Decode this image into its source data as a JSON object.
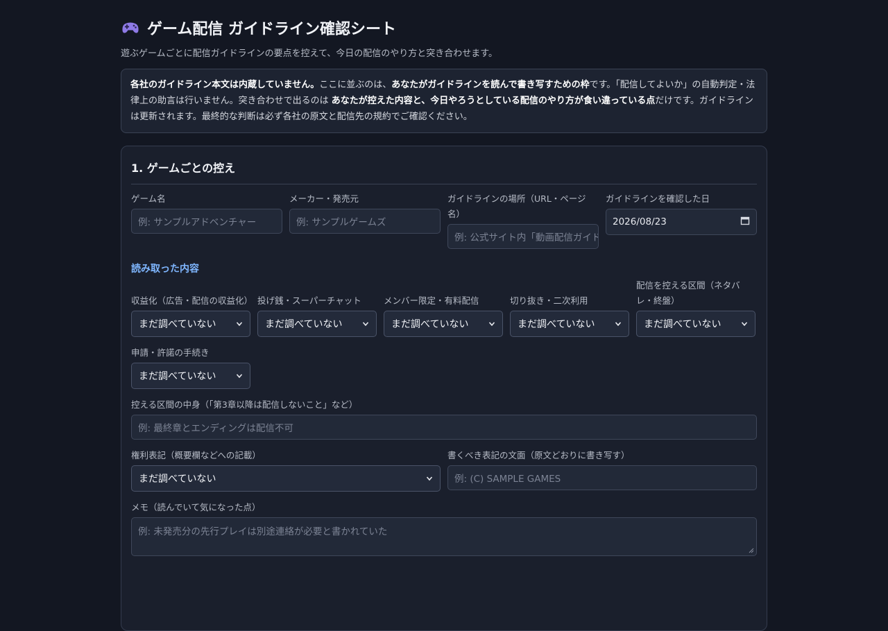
{
  "page": {
    "title": "ゲーム配信 ガイドライン確認シート",
    "title_icon": "gamepad-icon",
    "subtitle": "遊ぶゲームごとに配信ガイドラインの要点を控えて、今日の配信のやり方と突き合わせます。"
  },
  "notice": {
    "p1_b": "各社のガイドライン本文は内蔵していません。",
    "p2": "ここに並ぶのは、",
    "p3_b": "あなたがガイドラインを読んで書き写すための枠",
    "p4": "です。「配信してよいか」の自動判定・法律上の助言は行いません。突き合わせで出るのは ",
    "p5_b": "あなたが控えた内容と、今日やろうとしている配信のやり方が食い違っている点",
    "p6": "だけです。ガイドラインは更新されます。最終的な判断は必ず各社の原文と配信先の規約でご確認ください。"
  },
  "section": {
    "title": "1. ゲームごとの控え",
    "fields": {
      "game_name": {
        "label": "ゲーム名",
        "placeholder": "例: サンプルアドベンチャー"
      },
      "maker": {
        "label": "メーカー・発売元",
        "placeholder": "例: サンプルゲームズ"
      },
      "location": {
        "label": "ガイドラインの場所（URL・ページ名）",
        "placeholder": "例: 公式サイト内「動画配信ガイド」"
      },
      "checked_date": {
        "label": "ガイドラインを確認した日",
        "value": "2026/08/23"
      }
    },
    "read_header": "読み取った内容",
    "selects": [
      {
        "label": "収益化（広告・配信の収益化）",
        "value": "まだ調べていない"
      },
      {
        "label": "投げ銭・スーパーチャット",
        "value": "まだ調べていない"
      },
      {
        "label": "メンバー限定・有料配信",
        "value": "まだ調べていない"
      },
      {
        "label": "切り抜き・二次利用",
        "value": "まだ調べていない"
      },
      {
        "label": "配信を控える区間（ネタバレ・終盤）",
        "value": "まだ調べていない"
      }
    ],
    "permission": {
      "label": "申請・許諾の手続き",
      "value": "まだ調べていない"
    },
    "restricted": {
      "label": "控える区間の中身（「第3章以降は配信しないこと」など）",
      "placeholder": "例: 最終章とエンディングは配信不可"
    },
    "rights": {
      "label": "権利表記（概要欄などへの記載）",
      "value": "まだ調べていない"
    },
    "rights_text": {
      "label": "書くべき表記の文面（原文どおりに書き写す）",
      "placeholder": "例: (C) SAMPLE GAMES"
    },
    "memo": {
      "label": "メモ（読んでいて気になった点）",
      "placeholder": "例: 未発売分の先行プレイは別途連絡が必要と書かれていた"
    }
  }
}
